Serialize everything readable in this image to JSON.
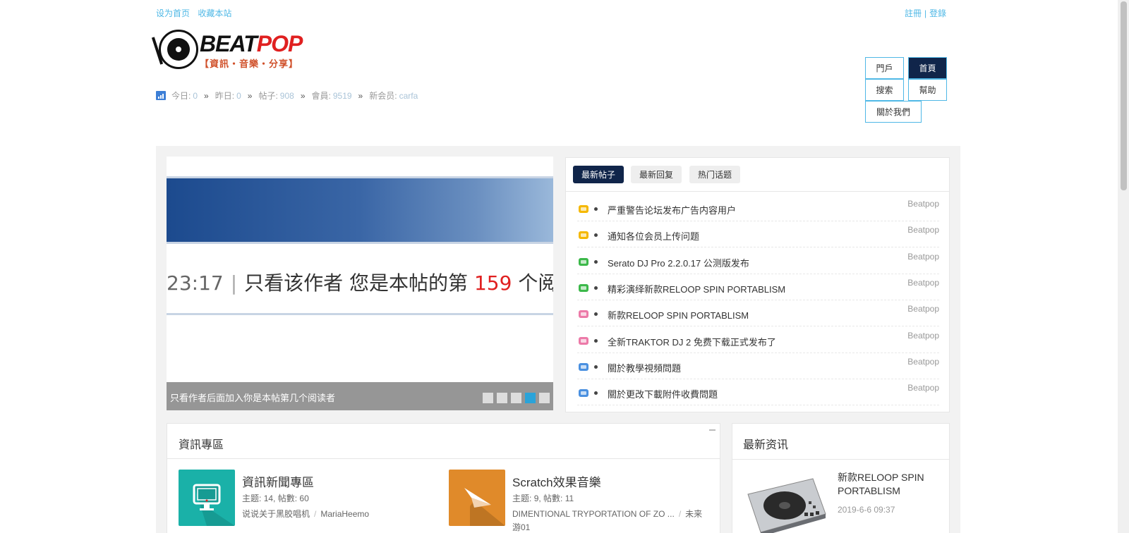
{
  "topbar": {
    "set_home": "设为首页",
    "bookmark": "收藏本站",
    "register": "註冊",
    "separator": "|",
    "login": "登錄"
  },
  "logo": {
    "beat": "BEAT",
    "pop": "POP",
    "tagline": "【資訊・音樂・分享】"
  },
  "stats": {
    "today_label": "今日:",
    "today_value": "0",
    "yesterday_label": "昨日:",
    "yesterday_value": "0",
    "posts_label": "帖子:",
    "posts_value": "908",
    "members_label": "會員:",
    "members_value": "9519",
    "newmember_label": "新会员:",
    "newmember_value": "carfa",
    "arrow": "»"
  },
  "nav": {
    "portal": "門戶",
    "home": "首頁",
    "search": "搜索",
    "help": "幫助",
    "about": "關於我們"
  },
  "slider": {
    "time": "23:17",
    "bar": "|",
    "text_a": "只看该作者  您是本帖的第",
    "number": "159",
    "text_b": "个阅读者",
    "caption": "只看作者后面加入你是本帖第几个阅读者"
  },
  "tabs": {
    "newest_posts": "最新帖子",
    "newest_replies": "最新回复",
    "hot_topics": "热门话题"
  },
  "threads": [
    {
      "title": "严重警告论坛发布广告内容用户",
      "author": "Beatpop",
      "icon_color": "#f5b800"
    },
    {
      "title": "通知各位会员上传问题",
      "author": "Beatpop",
      "icon_color": "#f5b800"
    },
    {
      "title": "Serato DJ Pro 2.2.0.17 公测版发布",
      "author": "Beatpop",
      "icon_color": "#3cb84a"
    },
    {
      "title": "精彩演绎新款RELOOP SPIN PORTABLISM",
      "author": "Beatpop",
      "icon_color": "#3cb84a"
    },
    {
      "title": "新款RELOOP SPIN PORTABLISM",
      "author": "Beatpop",
      "icon_color": "#ec7aa8"
    },
    {
      "title": "全新TRAKTOR DJ 2 免费下载正式发布了",
      "author": "Beatpop",
      "icon_color": "#ec7aa8"
    },
    {
      "title": "關於教學視頻問題",
      "author": "Beatpop",
      "icon_color": "#4a90e0"
    },
    {
      "title": "關於更改下載附件收費問題",
      "author": "Beatpop",
      "icon_color": "#4a90e0"
    }
  ],
  "news_zone": {
    "title": "資訊專區",
    "forums": [
      {
        "name": "資訊新聞專區",
        "topics_label": "主题:",
        "topics": "14",
        "posts_label": "帖數:",
        "posts": "60",
        "last_post": "说说关于黑胶唱机",
        "slash": "/",
        "last_author": "MariaHeemo",
        "icon_color": "#1ab1a8"
      },
      {
        "name": "Scratch效果音樂",
        "topics_label": "主题:",
        "topics": "9",
        "posts_label": "帖數:",
        "posts": "11",
        "last_post": "DIMENTIONAL TRYPORTATION OF ZO ...",
        "slash": "/",
        "last_author": "未来游01",
        "icon_color": "#e08a2a"
      }
    ]
  },
  "latest": {
    "title": "最新资讯",
    "item_name": "新款RELOOP SPIN PORTABLISM",
    "item_date": "2019-6-6 09:37"
  }
}
